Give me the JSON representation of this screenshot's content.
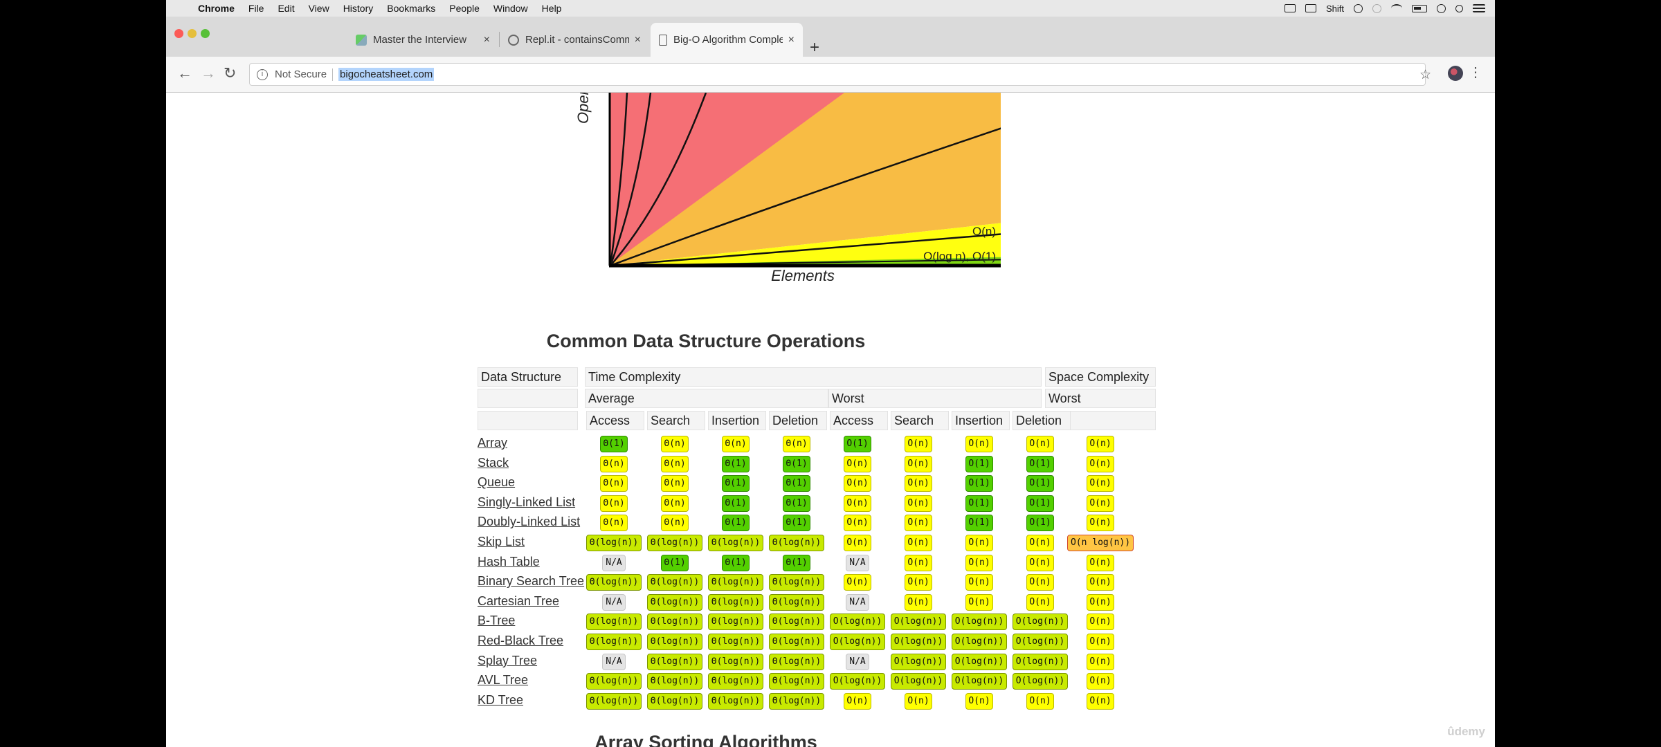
{
  "menubar": {
    "app": "Chrome",
    "items": [
      "File",
      "Edit",
      "View",
      "History",
      "Bookmarks",
      "People",
      "Window",
      "Help"
    ],
    "shift_label": "Shift"
  },
  "tabs": [
    {
      "label": "Master the Interview",
      "close": "×"
    },
    {
      "label": "Repl.it - containsCommonItem",
      "close": "×"
    },
    {
      "label": "Big-O Algorithm Complexity Ch",
      "close": "×"
    }
  ],
  "newtab": "+",
  "toolbar": {
    "back": "←",
    "forward": "→",
    "reload": "↻",
    "security": "Not Secure",
    "info_glyph": "i",
    "url": "bigocheatsheet.com",
    "star": "☆",
    "kebab": "⋮"
  },
  "chart": {
    "ylabel": "Operati",
    "xlabel": "Elements",
    "label_on": "O(n)",
    "label_log": "O(log n), O(1)",
    "colors": {
      "red": "#f56f75",
      "orange": "#f8bc44",
      "yellow": "#ffff10",
      "green": "#7ed612"
    }
  },
  "section_title": "Common Data Structure Operations",
  "table": {
    "h_ds": "Data Structure",
    "h_time": "Time Complexity",
    "h_space": "Space Complexity",
    "h_average": "Average",
    "h_worst": "Worst",
    "h_space_worst": "Worst",
    "ops": [
      "Access",
      "Search",
      "Insertion",
      "Deletion",
      "Access",
      "Search",
      "Insertion",
      "Deletion"
    ],
    "rows": [
      {
        "name": "Array",
        "cells": [
          "Θ(1)",
          "Θ(n)",
          "Θ(n)",
          "Θ(n)",
          "O(1)",
          "O(n)",
          "O(n)",
          "O(n)"
        ],
        "space": "O(n)"
      },
      {
        "name": "Stack",
        "cells": [
          "Θ(n)",
          "Θ(n)",
          "Θ(1)",
          "Θ(1)",
          "O(n)",
          "O(n)",
          "O(1)",
          "O(1)"
        ],
        "space": "O(n)"
      },
      {
        "name": "Queue",
        "cells": [
          "Θ(n)",
          "Θ(n)",
          "Θ(1)",
          "Θ(1)",
          "O(n)",
          "O(n)",
          "O(1)",
          "O(1)"
        ],
        "space": "O(n)"
      },
      {
        "name": "Singly-Linked List",
        "cells": [
          "Θ(n)",
          "Θ(n)",
          "Θ(1)",
          "Θ(1)",
          "O(n)",
          "O(n)",
          "O(1)",
          "O(1)"
        ],
        "space": "O(n)"
      },
      {
        "name": "Doubly-Linked List",
        "cells": [
          "Θ(n)",
          "Θ(n)",
          "Θ(1)",
          "Θ(1)",
          "O(n)",
          "O(n)",
          "O(1)",
          "O(1)"
        ],
        "space": "O(n)"
      },
      {
        "name": "Skip List",
        "cells": [
          "Θ(log(n))",
          "Θ(log(n))",
          "Θ(log(n))",
          "Θ(log(n))",
          "O(n)",
          "O(n)",
          "O(n)",
          "O(n)"
        ],
        "space": "O(n log(n))"
      },
      {
        "name": "Hash Table",
        "cells": [
          "N/A",
          "Θ(1)",
          "Θ(1)",
          "Θ(1)",
          "N/A",
          "O(n)",
          "O(n)",
          "O(n)"
        ],
        "space": "O(n)"
      },
      {
        "name": "Binary Search Tree",
        "cells": [
          "Θ(log(n))",
          "Θ(log(n))",
          "Θ(log(n))",
          "Θ(log(n))",
          "O(n)",
          "O(n)",
          "O(n)",
          "O(n)"
        ],
        "space": "O(n)"
      },
      {
        "name": "Cartesian Tree",
        "cells": [
          "N/A",
          "Θ(log(n))",
          "Θ(log(n))",
          "Θ(log(n))",
          "N/A",
          "O(n)",
          "O(n)",
          "O(n)"
        ],
        "space": "O(n)"
      },
      {
        "name": "B-Tree",
        "cells": [
          "Θ(log(n))",
          "Θ(log(n))",
          "Θ(log(n))",
          "Θ(log(n))",
          "O(log(n))",
          "O(log(n))",
          "O(log(n))",
          "O(log(n))"
        ],
        "space": "O(n)"
      },
      {
        "name": "Red-Black Tree",
        "cells": [
          "Θ(log(n))",
          "Θ(log(n))",
          "Θ(log(n))",
          "Θ(log(n))",
          "O(log(n))",
          "O(log(n))",
          "O(log(n))",
          "O(log(n))"
        ],
        "space": "O(n)"
      },
      {
        "name": "Splay Tree",
        "cells": [
          "N/A",
          "Θ(log(n))",
          "Θ(log(n))",
          "Θ(log(n))",
          "N/A",
          "O(log(n))",
          "O(log(n))",
          "O(log(n))"
        ],
        "space": "O(n)"
      },
      {
        "name": "AVL Tree",
        "cells": [
          "Θ(log(n))",
          "Θ(log(n))",
          "Θ(log(n))",
          "Θ(log(n))",
          "O(log(n))",
          "O(log(n))",
          "O(log(n))",
          "O(log(n))"
        ],
        "space": "O(n)"
      },
      {
        "name": "KD Tree",
        "cells": [
          "Θ(log(n))",
          "Θ(log(n))",
          "Θ(log(n))",
          "Θ(log(n))",
          "O(n)",
          "O(n)",
          "O(n)",
          "O(n)"
        ],
        "space": "O(n)"
      }
    ],
    "color_classes": {
      "Θ(1)": "green",
      "O(1)": "green",
      "Θ(log(n))": "lgreen",
      "O(log(n))": "lgreen",
      "Θ(n)": "yellow",
      "O(n)": "yellow",
      "O(n log(n))": "orange",
      "N/A": "na"
    }
  },
  "next_section_title": "Array Sorting Algorithms",
  "watermark": "ûdemy"
}
